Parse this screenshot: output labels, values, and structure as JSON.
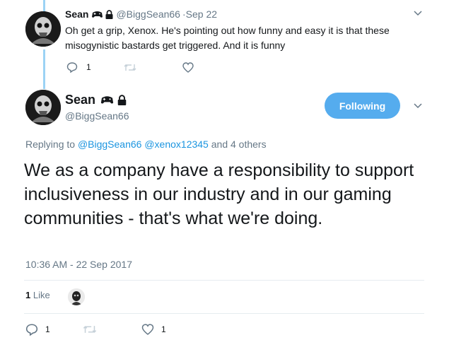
{
  "reply_tweet": {
    "name": "Sean",
    "handle": "@BiggSean66",
    "date": "·Sep 22",
    "text": "Oh get a grip, Xenox. He's pointing out how funny and easy it is that these misogynistic bastards get triggered. And it is funny",
    "reply_count": "1",
    "retweet_count": "",
    "like_count": ""
  },
  "main_tweet": {
    "name": "Sean",
    "handle": "@BiggSean66",
    "follow_label": "Following",
    "replying_prefix": "Replying to",
    "replying_user1": "@BiggSean66",
    "replying_user2": "@xenox12345",
    "replying_suffix": "and 4 others",
    "text": "We as a company have a responsibility to support inclusiveness in our industry and in our gaming communities - that's what we're doing.",
    "timestamp": "10:36 AM - 22 Sep 2017",
    "likes_count": "1",
    "likes_label": "Like",
    "reply_count": "1",
    "retweet_count": "",
    "like_count": "1"
  },
  "colors": {
    "accent": "#1b95e0",
    "follow_button": "#55acee",
    "muted": "#657786",
    "thread_line": "#9cd3f5"
  },
  "icons": {
    "name_badge_1": "gamepad-icon",
    "name_badge_2": "lock-icon",
    "reply": "reply-icon",
    "retweet": "retweet-icon",
    "like": "heart-icon",
    "more": "chevron-down-icon"
  }
}
